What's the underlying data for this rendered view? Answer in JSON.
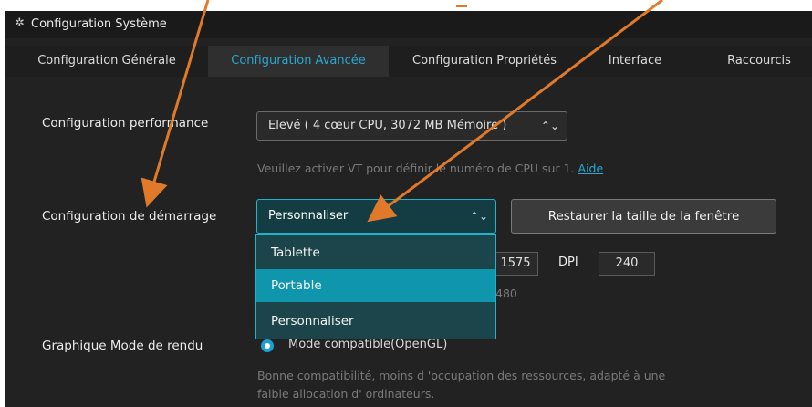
{
  "window": {
    "title": "Configuration Système",
    "gear_icon": "gear-icon"
  },
  "tabs": [
    {
      "label": "Configuration Générale"
    },
    {
      "label": "Configuration Avancée",
      "active": true
    },
    {
      "label": "Configuration Propriétés"
    },
    {
      "label": "Interface"
    },
    {
      "label": "Raccourcis"
    }
  ],
  "performance": {
    "label": "Configuration performance",
    "selected": "Elevé ( 4 cœur CPU, 3072 MB Mémoire )",
    "hint_text": "Veuillez activer VT pour définir le numéro de CPU sur 1.",
    "hint_link": "Aide"
  },
  "startup": {
    "label": "Configuration de démarrage",
    "selected": "Personnaliser",
    "restore_button": "Restaurer la taille de la fenêtre",
    "options": [
      "Tablette",
      "Portable",
      "Personnaliser"
    ],
    "highlighted_option": "Portable",
    "height_partial": "1575",
    "dpi_label": "DPI",
    "dpi_value": "240",
    "resolution_hint_partial": "480"
  },
  "render": {
    "label": "Graphique Mode de rendu",
    "selected_mode": "Mode compatible(OpenGL)",
    "desc_line1": "Bonne compatibilité, moins d   'occupation des ressources, adapté à une",
    "desc_line2": "faible allocation d'   ordinateurs."
  },
  "colors": {
    "accent": "#2aa8d0",
    "annotation_arrow": "#e07a2a",
    "dropdown_highlight": "#0f96ac"
  }
}
